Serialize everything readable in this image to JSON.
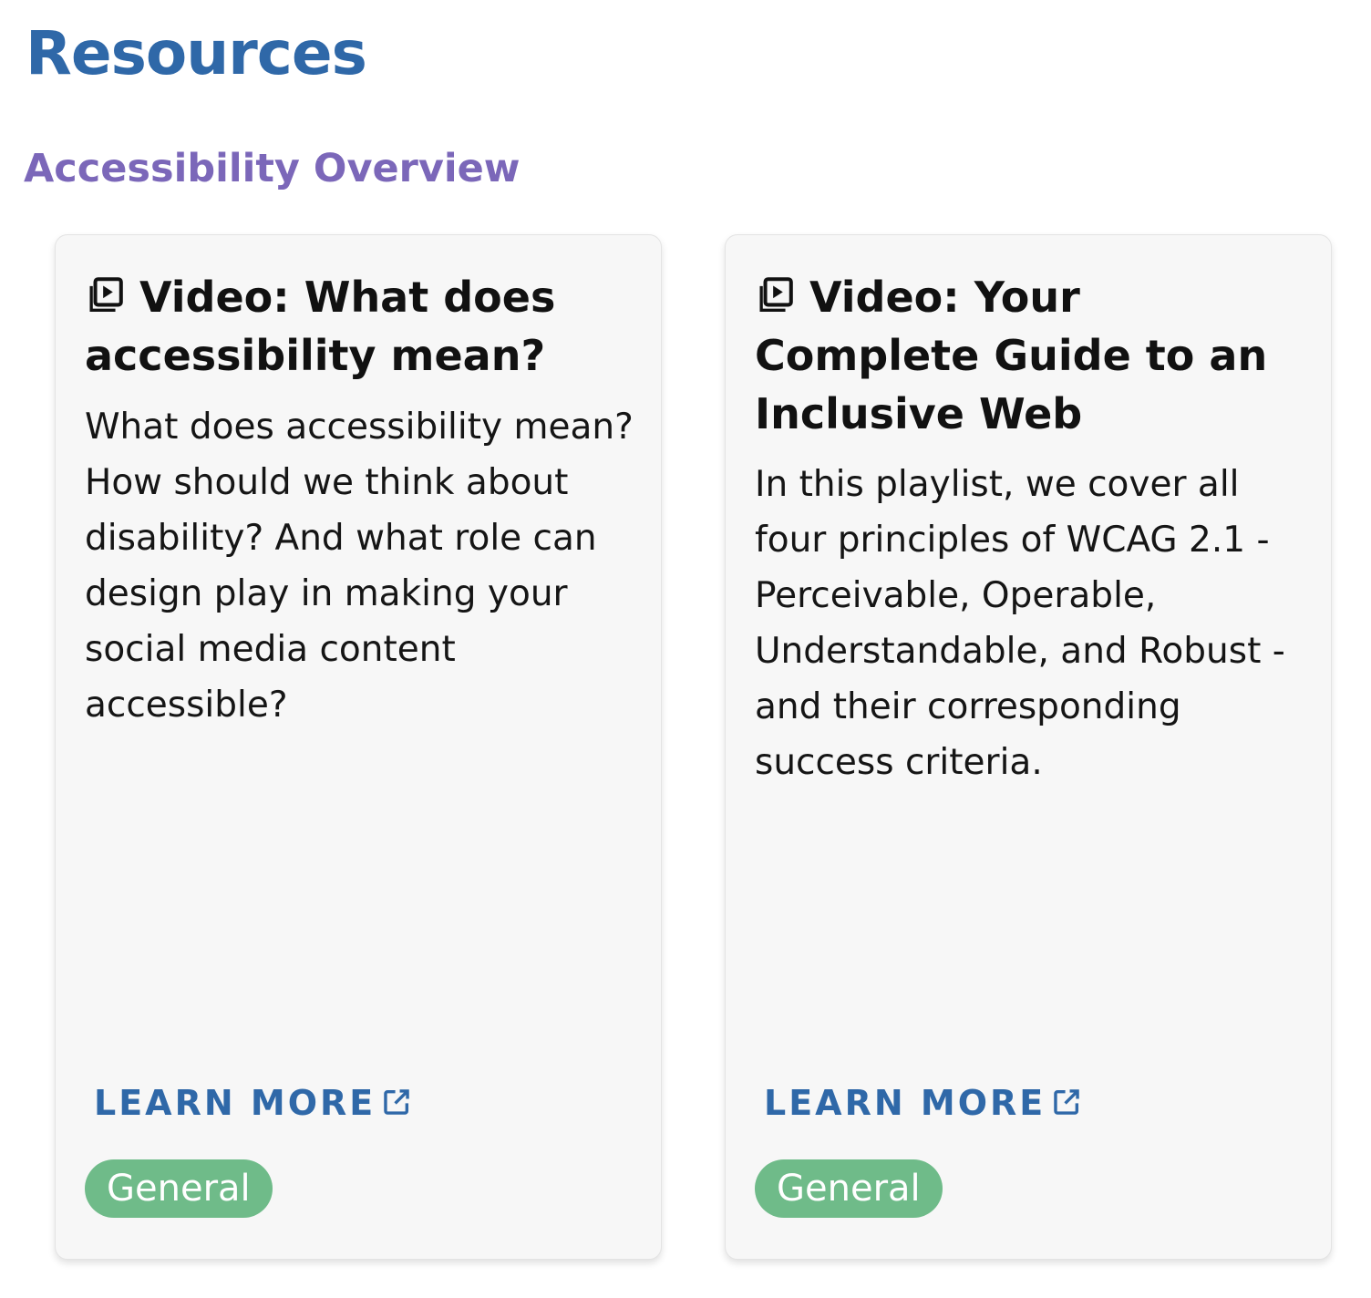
{
  "page": {
    "title": "Resources"
  },
  "section": {
    "title": "Accessibility Overview"
  },
  "cards": [
    {
      "icon": "video-library-icon",
      "title": "Video: What does accessibility mean?",
      "description": "What does accessibility mean? How should we think about disability? And what role can design play in making your social media content accessible?",
      "link_label": "LEARN MORE",
      "link_icon": "external-link-icon",
      "tag": "General"
    },
    {
      "icon": "video-library-icon",
      "title": "Video: Your Complete Guide to an Inclusive Web",
      "description": "In this playlist, we cover all four principles of WCAG 2.1 - Perceivable, Operable, Understandable, and Robust - and their corresponding success criteria.",
      "link_label": "LEARN MORE",
      "link_icon": "external-link-icon",
      "tag": "General"
    }
  ],
  "colors": {
    "page_title": "#2f68a8",
    "section_title": "#7b67b9",
    "link": "#2f68a8",
    "tag_background": "#6fbb89",
    "card_background": "#f7f7f7"
  }
}
